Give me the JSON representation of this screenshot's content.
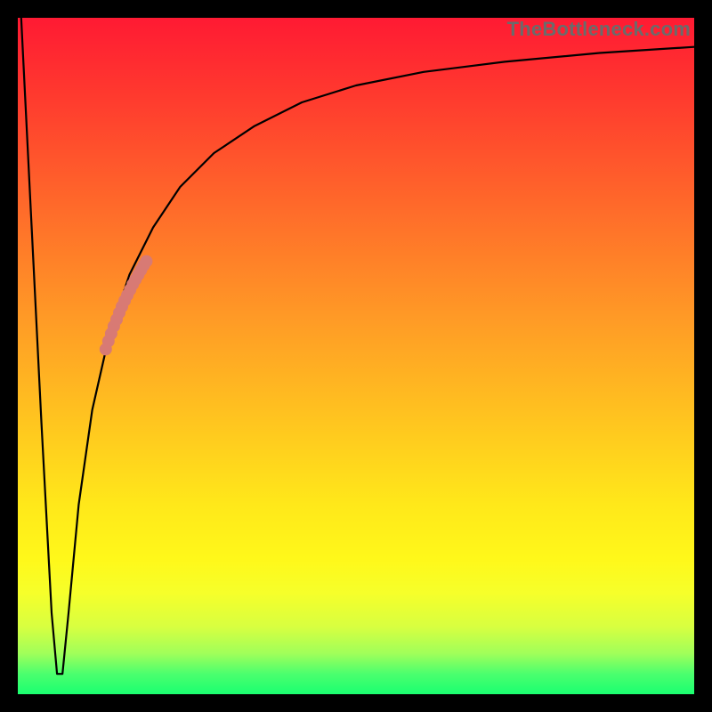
{
  "watermark": "TheBottleneck.com",
  "chart_data": {
    "type": "line",
    "title": "",
    "xlabel": "",
    "ylabel": "",
    "xlim": [
      0,
      100
    ],
    "ylim": [
      0,
      100
    ],
    "grid": false,
    "legend": false,
    "series": [
      {
        "name": "bottleneck-curve",
        "x": [
          0.5,
          2.0,
          3.5,
          5.0,
          5.8,
          6.6,
          7.5,
          9.0,
          11.0,
          13.5,
          16.5,
          20.0,
          24.0,
          29.0,
          35.0,
          42.0,
          50.0,
          60.0,
          72.0,
          86.0,
          100.0
        ],
        "y": [
          100,
          70,
          40,
          12,
          3,
          3,
          12,
          28,
          42,
          53,
          62,
          69,
          75,
          80,
          84,
          87.5,
          90,
          92,
          93.5,
          94.8,
          95.7
        ]
      }
    ],
    "highlight_points": {
      "name": "highlighted-segment",
      "color": "#d87a74",
      "points": [
        {
          "x": 13.0,
          "y": 51.0
        },
        {
          "x": 13.4,
          "y": 52.2
        },
        {
          "x": 13.8,
          "y": 53.3
        },
        {
          "x": 14.2,
          "y": 54.4
        },
        {
          "x": 14.6,
          "y": 55.4
        },
        {
          "x": 15.0,
          "y": 56.4
        },
        {
          "x": 15.4,
          "y": 57.3
        },
        {
          "x": 15.8,
          "y": 58.2
        },
        {
          "x": 16.2,
          "y": 59.0
        },
        {
          "x": 16.6,
          "y": 59.8
        },
        {
          "x": 17.0,
          "y": 60.6
        },
        {
          "x": 17.4,
          "y": 61.3
        },
        {
          "x": 17.8,
          "y": 62.0
        },
        {
          "x": 18.2,
          "y": 62.7
        },
        {
          "x": 18.6,
          "y": 63.4
        },
        {
          "x": 19.0,
          "y": 64.0
        }
      ]
    },
    "background_gradient": {
      "direction": "vertical",
      "stops": [
        {
          "pos": 0.0,
          "color": "#ff1a33"
        },
        {
          "pos": 0.3,
          "color": "#ff7a28"
        },
        {
          "pos": 0.6,
          "color": "#ffd41f"
        },
        {
          "pos": 0.82,
          "color": "#fff81a"
        },
        {
          "pos": 0.92,
          "color": "#c8ff45"
        },
        {
          "pos": 1.0,
          "color": "#1aff70"
        }
      ]
    }
  }
}
